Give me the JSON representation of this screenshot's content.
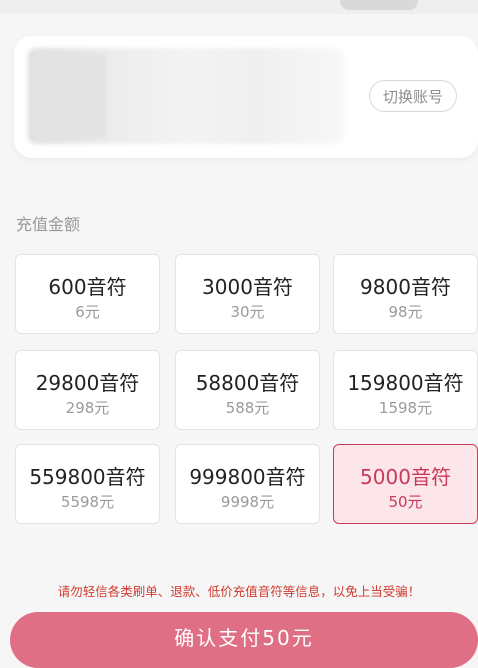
{
  "account": {
    "switch_label": "切换账号"
  },
  "recharge": {
    "section_label": "充值金额",
    "options": [
      {
        "amount": "600音符",
        "price": "6元",
        "selected": false
      },
      {
        "amount": "3000音符",
        "price": "30元",
        "selected": false
      },
      {
        "amount": "9800音符",
        "price": "98元",
        "selected": false
      },
      {
        "amount": "29800音符",
        "price": "298元",
        "selected": false
      },
      {
        "amount": "58800音符",
        "price": "588元",
        "selected": false
      },
      {
        "amount": "159800音符",
        "price": "1598元",
        "selected": false
      },
      {
        "amount": "559800音符",
        "price": "5598元",
        "selected": false
      },
      {
        "amount": "999800音符",
        "price": "9998元",
        "selected": false
      },
      {
        "amount": "5000音符",
        "price": "50元",
        "selected": true
      }
    ]
  },
  "notice": {
    "warning": "请勿轻信各类刷单、退款、低价充值音符等信息，以免上当受骗！"
  },
  "payment": {
    "confirm_label": "确认支付50元"
  },
  "colors": {
    "accent": "#c8395a",
    "selected_bg": "#fde6ea",
    "button_bg": "#df6f84",
    "warning": "#d13a2f"
  }
}
